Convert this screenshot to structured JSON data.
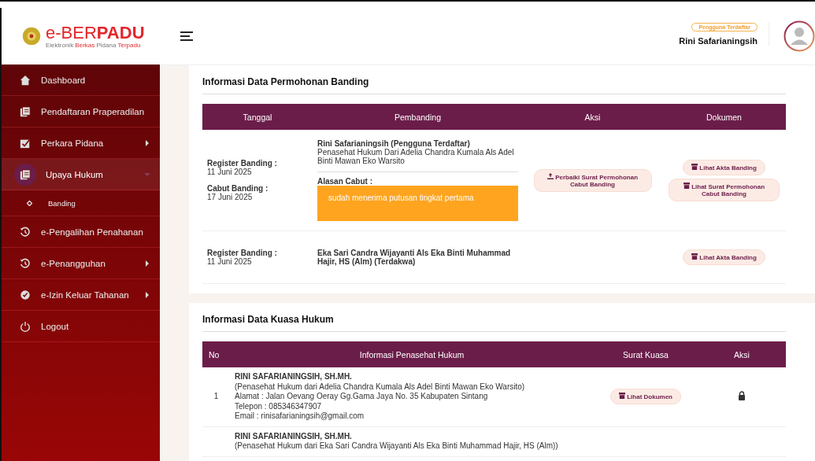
{
  "logo": {
    "title_a": "e-",
    "title_b": "BER",
    "title_c": "PADU",
    "subtitle": [
      {
        "text": "Elektronik ",
        "accent": false
      },
      {
        "text": "Berkas ",
        "accent": true
      },
      {
        "text": "Pidana ",
        "accent": false
      },
      {
        "text": "Terpadu",
        "accent": true
      }
    ]
  },
  "sidebar": {
    "items": [
      {
        "label": "Dashboard",
        "kind": "link",
        "selected": false
      },
      {
        "label": "Pendaftaran Praperadilan",
        "kind": "link",
        "selected": false
      },
      {
        "label": "Perkara Pidana",
        "kind": "menu",
        "selected": false,
        "expanded": false
      },
      {
        "label": "Upaya Hukum",
        "kind": "menu",
        "selected": true,
        "expanded": true,
        "children": [
          {
            "label": "Banding",
            "selected": false
          }
        ]
      },
      {
        "label": "e-Pengalihan Penahanan",
        "kind": "link",
        "selected": false
      },
      {
        "label": "e-Penangguhan",
        "kind": "menu",
        "selected": false,
        "expanded": false
      },
      {
        "label": "e-Izin Keluar Tahanan",
        "kind": "menu",
        "selected": false,
        "expanded": false
      },
      {
        "label": "Logout",
        "kind": "link",
        "selected": false
      }
    ]
  },
  "header": {
    "user_badge": "Pengguna Terdaftar",
    "user_name": "Rini Safarianingsih"
  },
  "banding": {
    "title": "Informasi Data Permohonan Banding",
    "columns": [
      "Tanggal",
      "Pembanding",
      "Aksi",
      "Dokumen"
    ],
    "rows": [
      {
        "dates": [
          {
            "label": "Register Banding :",
            "value": "11 Juni 2025"
          },
          {
            "label": "Cabut Banding :",
            "value": "17 Juni 2025"
          }
        ],
        "name": "Rini Safarianingsih (Pengguna Terdaftar)",
        "desc": "Penasehat Hukum Dari Adelia Chandra Kumala Als Adel Binti Mawan Eko Warsito",
        "reason_label": "Alasan Cabut :",
        "reason": "sudah menerima putusan tingkat pertama",
        "actions": [
          "Perbaiki Surat Permohonan Cabut Banding"
        ],
        "documents": [
          "Lihat Akta Banding",
          "Lihat Surat Permohonan Cabut Banding"
        ]
      },
      {
        "dates": [
          {
            "label": "Register Banding :",
            "value": "11 Juni 2025"
          }
        ],
        "name": "Eka Sari Candra Wijayanti Als Eka Binti Muhammad Hajir, HS (Alm) (Terdakwa)",
        "actions": [],
        "documents": [
          "Lihat Akta Banding"
        ]
      }
    ]
  },
  "kuasa": {
    "title": "Informasi Data Kuasa Hukum",
    "columns": [
      "No",
      "Informasi Penasehat Hukum",
      "Surat Kuasa",
      "Aksi"
    ],
    "rows": [
      {
        "no": "1",
        "name": "RINI SAFARIANINGSIH, SH.MH.",
        "lines": [
          "(Penasehat Hukum dari Adelia Chandra Kumala Als Adel Binti Mawan Eko Warsito)",
          "Alamat : Jalan Oevang Oeray Gg.Gama Jaya No. 35 Kabupaten Sintang",
          "Telepon : 085346347907",
          "Email : rinisafarianingsih@gmail.com"
        ],
        "document": "Lihat Dokumen",
        "locked": true
      },
      {
        "no": "",
        "name": "RINI SAFARIANINGSIH, SH.MH.",
        "lines": [
          "(Penasehat Hukum dari Eka Sari Candra Wijayanti Als Eka Binti Muhammad Hajir, HS (Alm))"
        ],
        "document": ""
      }
    ]
  }
}
